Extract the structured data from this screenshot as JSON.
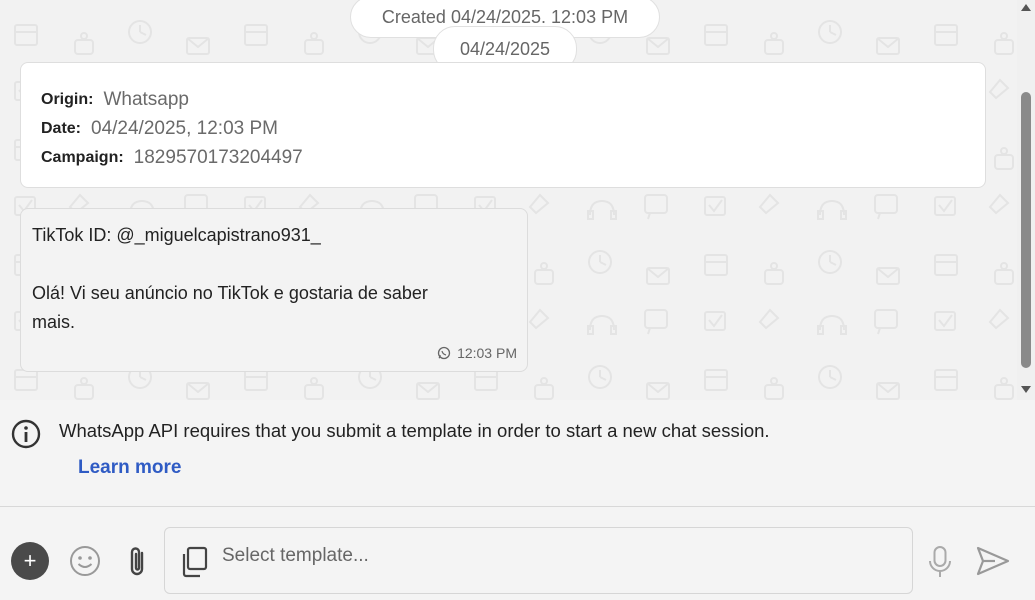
{
  "chat": {
    "created_label": "Created 04/24/2025. 12:03 PM",
    "date_divider": "04/24/2025",
    "info_card": {
      "origin_label": "Origin:",
      "origin_value": "Whatsapp",
      "date_label": "Date:",
      "date_value": "04/24/2025, 12:03 PM",
      "campaign_label": "Campaign:",
      "campaign_value": "1829570173204497"
    },
    "message": {
      "text": "TikTok ID: @_miguelcapistrano931_\n\nOlá! Vi seu anúncio no TikTok e gostaria de saber\nmais.",
      "time": "12:03 PM",
      "channel_icon": "whatsapp-icon"
    }
  },
  "notice": {
    "icon": "info-icon",
    "text": "WhatsApp API requires that you submit a template in order to start a new chat session.",
    "learn_more": "Learn more"
  },
  "composer": {
    "plus_label": "+",
    "template_placeholder": "Select template...",
    "icons": [
      "plus-icon",
      "emoji-icon",
      "paperclip-icon",
      "copy-icon",
      "microphone-icon",
      "send-icon"
    ]
  },
  "colors": {
    "link": "#2f5bc4",
    "background": "#f4f4f4",
    "card": "#ffffff",
    "plus_button": "#4a4a4a"
  }
}
